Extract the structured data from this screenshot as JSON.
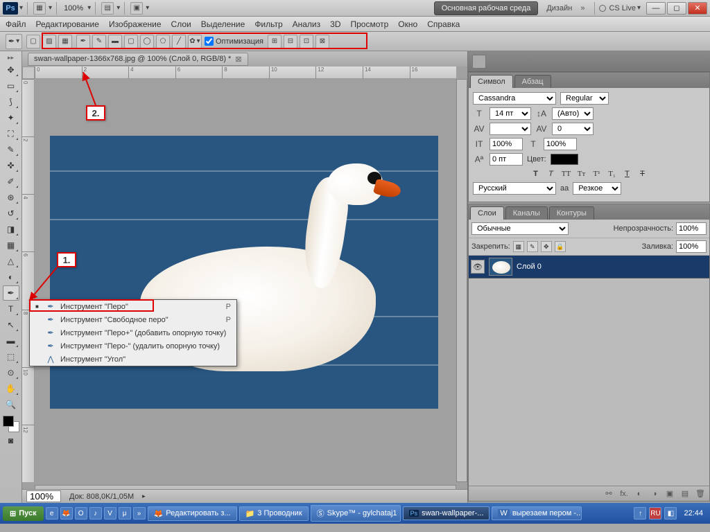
{
  "titlebar": {
    "logo": "Ps",
    "zoom": "100%",
    "workspace_btn": "Основная рабочая среда",
    "design_btn": "Дизайн",
    "cslive": "CS Live"
  },
  "menu": [
    "Файл",
    "Редактирование",
    "Изображение",
    "Слои",
    "Выделение",
    "Фильтр",
    "Анализ",
    "3D",
    "Просмотр",
    "Окно",
    "Справка"
  ],
  "options": {
    "optimize_label": "Оптимизация"
  },
  "doc_tab": {
    "title": "swan-wallpaper-1366x768.jpg @ 100% (Слой 0, RGB/8) *"
  },
  "ruler_h": [
    "0",
    "2",
    "4",
    "6",
    "8",
    "10",
    "12",
    "14",
    "16"
  ],
  "ruler_v": [
    "0",
    "2",
    "4",
    "6",
    "8",
    "10",
    "12"
  ],
  "flyout": [
    {
      "mark": "■",
      "icon": "✒",
      "label": "Инструмент \"Перо\"",
      "shortcut": "P"
    },
    {
      "mark": "",
      "icon": "✒",
      "label": "Инструмент \"Свободное перо\"",
      "shortcut": "P"
    },
    {
      "mark": "",
      "icon": "✒",
      "label": "Инструмент \"Перо+\" (добавить опорную точку)",
      "shortcut": ""
    },
    {
      "mark": "",
      "icon": "✒",
      "label": "Инструмент \"Перо-\" (удалить опорную точку)",
      "shortcut": ""
    },
    {
      "mark": "",
      "icon": "⋀",
      "label": "Инструмент \"Угол\"",
      "shortcut": ""
    }
  ],
  "status": {
    "zoom": "100%",
    "doc_info": "Док: 808,0K/1,05M"
  },
  "callouts": {
    "one": "1.",
    "two": "2."
  },
  "char_panel": {
    "tabs": [
      "Символ",
      "Абзац"
    ],
    "font": "Cassandra",
    "style": "Regular",
    "size": "14 пт",
    "leading": "(Авто)",
    "tracking": "0",
    "kerning": "",
    "vscale": "100%",
    "hscale": "100%",
    "baseline": "0 пт",
    "color_label": "Цвет:",
    "lang": "Русский",
    "aa_label": "aа",
    "aa": "Резкое"
  },
  "layers_panel": {
    "tabs": [
      "Слои",
      "Каналы",
      "Контуры"
    ],
    "blend": "Обычные",
    "opacity_label": "Непрозрачность:",
    "opacity": "100%",
    "lock_label": "Закрепить:",
    "fill_label": "Заливка:",
    "fill": "100%",
    "layer0": "Слой 0"
  },
  "taskbar": {
    "start": "Пуск",
    "tasks": [
      {
        "icon": "🦊",
        "label": "Редактировать з..."
      },
      {
        "icon": "📁",
        "label": "3 Проводник"
      },
      {
        "icon": "Ⓢ",
        "label": "Skype™ - gylchataj1"
      },
      {
        "icon": "Ps",
        "label": "swan-wallpaper-..."
      },
      {
        "icon": "W",
        "label": "вырезаем пером -..."
      }
    ],
    "clock": "22:44"
  }
}
